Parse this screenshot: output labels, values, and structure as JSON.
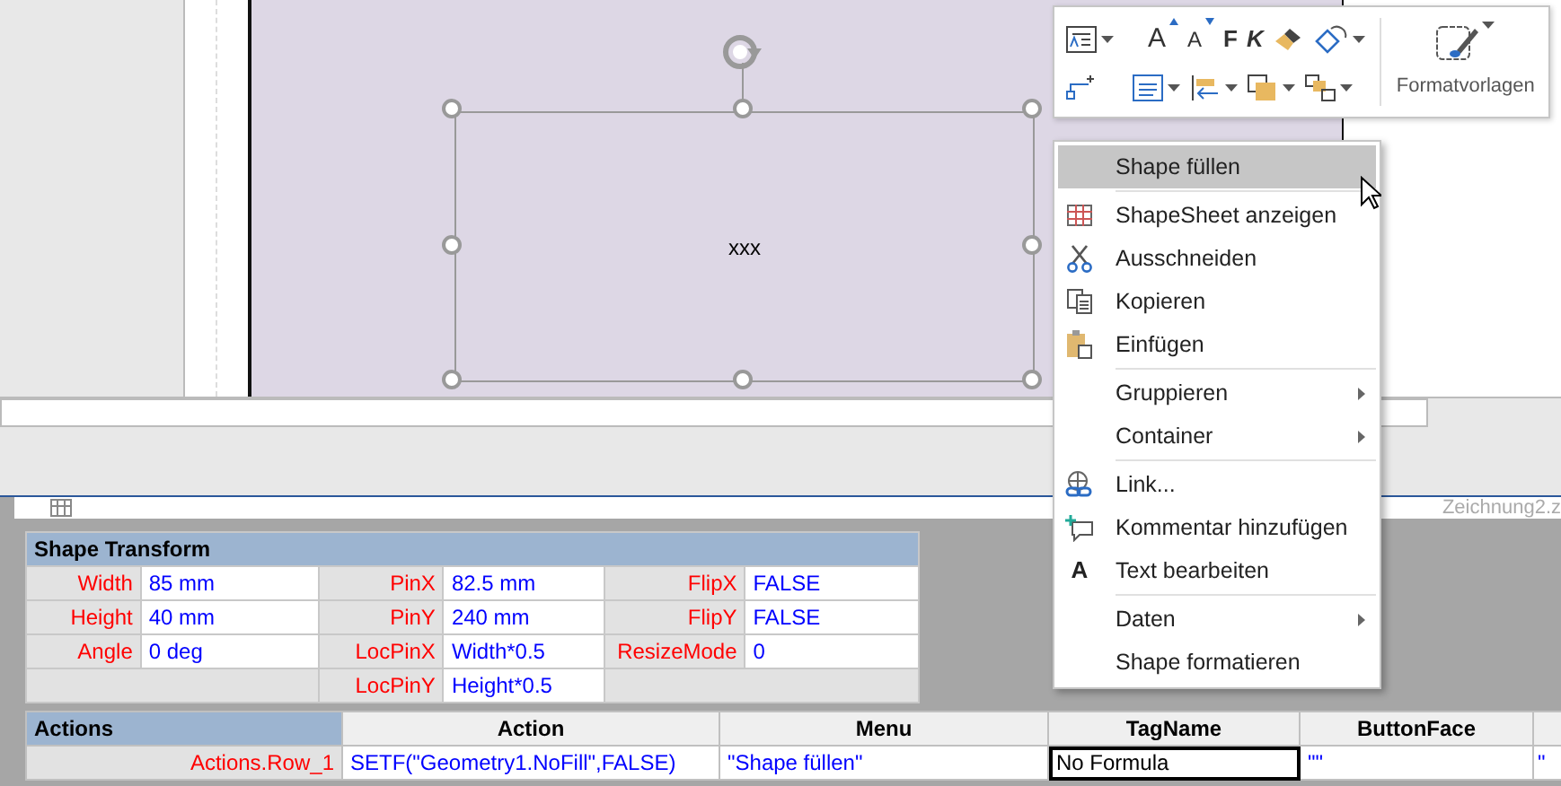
{
  "canvas": {
    "shape": {
      "text": "xxx",
      "selected": true
    }
  },
  "document_tab": {
    "title": "Zeichnung2.z"
  },
  "mini_toolbar": {
    "row_1": [
      {
        "kind": "shape-style",
        "dropdown": true
      },
      {
        "kind": "grow-font",
        "text": "A",
        "dropdown": false
      },
      {
        "kind": "shrink-font",
        "text": "A",
        "dropdown": false
      },
      {
        "kind": "bold",
        "text": "F",
        "dropdown": false
      },
      {
        "kind": "italic",
        "text": "K",
        "dropdown": false
      },
      {
        "kind": "fill",
        "dropdown": false
      },
      {
        "kind": "outline",
        "dropdown": true
      }
    ],
    "row_2": [
      {
        "kind": "connector",
        "dropdown": false
      },
      {
        "kind": "align",
        "dropdown": true
      },
      {
        "kind": "position",
        "dropdown": true
      },
      {
        "kind": "forward",
        "dropdown": true
      },
      {
        "kind": "backward",
        "dropdown": true
      }
    ],
    "styles_button": {
      "label": "Formatvorlagen",
      "dropdown": true
    }
  },
  "context_menu": {
    "groups": [
      [
        {
          "label": "Shape füllen",
          "kind": "plain",
          "selected": true,
          "submenu": false
        }
      ],
      [
        {
          "label": "ShapeSheet anzeigen",
          "kind": "sheet",
          "selected": false,
          "submenu": false
        },
        {
          "label": "Ausschneiden",
          "kind": "cut",
          "selected": false,
          "submenu": false
        },
        {
          "label": "Kopieren",
          "kind": "copy",
          "selected": false,
          "submenu": false
        },
        {
          "label": "Einfügen",
          "kind": "paste",
          "selected": false,
          "submenu": false
        }
      ],
      [
        {
          "label": "Gruppieren",
          "kind": "plain",
          "selected": false,
          "submenu": true
        },
        {
          "label": "Container",
          "kind": "plain",
          "selected": false,
          "submenu": true
        }
      ],
      [
        {
          "label": "Link...",
          "kind": "link",
          "selected": false,
          "submenu": false
        },
        {
          "label": "Kommentar hinzufügen",
          "kind": "comment",
          "selected": false,
          "submenu": false
        },
        {
          "label": "Text bearbeiten",
          "kind": "letter",
          "icon_text": "A",
          "selected": false,
          "submenu": false
        }
      ],
      [
        {
          "label": "Daten",
          "kind": "plain",
          "selected": false,
          "submenu": true
        },
        {
          "label": "Shape formatieren",
          "kind": "plain",
          "selected": false,
          "submenu": false
        }
      ]
    ]
  },
  "shape_transform": {
    "title": "Shape Transform",
    "rows": [
      [
        {
          "name": "Width",
          "value": "85 mm"
        },
        {
          "name": "PinX",
          "value": "82.5 mm"
        },
        {
          "name": "FlipX",
          "value": "FALSE"
        }
      ],
      [
        {
          "name": "Height",
          "value": "40 mm"
        },
        {
          "name": "PinY",
          "value": "240 mm"
        },
        {
          "name": "FlipY",
          "value": "FALSE"
        }
      ],
      [
        {
          "name": "Angle",
          "value": "0 deg"
        },
        {
          "name": "LocPinX",
          "value": "Width*0.5"
        },
        {
          "name": "ResizeMode",
          "value": "0"
        }
      ],
      [
        null,
        {
          "name": "LocPinY",
          "value": "Height*0.5"
        },
        null
      ]
    ]
  },
  "actions": {
    "columns": [
      "Actions",
      "Action",
      "Menu",
      "TagName",
      "ButtonFace"
    ],
    "rows": [
      {
        "cells": [
          {
            "text": "Actions.Row_1",
            "selected": false
          },
          {
            "text": "SETF(\"Geometry1.NoFill\",FALSE)",
            "selected": false
          },
          {
            "text": "\"Shape füllen\"",
            "selected": false
          },
          {
            "text": "No Formula",
            "selected": true
          },
          {
            "text": "\"\"",
            "selected": false
          },
          {
            "text": "\"",
            "selected": false
          }
        ]
      }
    ]
  }
}
